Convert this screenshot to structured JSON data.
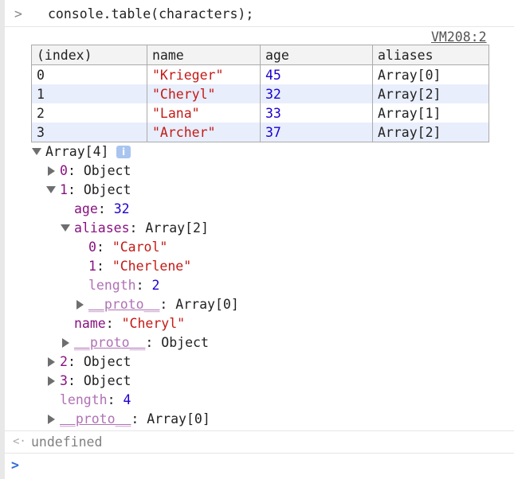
{
  "console": {
    "command_prompt": ">",
    "command": "console.table(characters);",
    "source_link": "VM208:2",
    "table": {
      "headers": [
        "(index)",
        "name",
        "age",
        "aliases"
      ],
      "rows": [
        {
          "index": "0",
          "name": "\"Krieger\"",
          "age": "45",
          "aliases": "Array[0]"
        },
        {
          "index": "1",
          "name": "\"Cheryl\"",
          "age": "32",
          "aliases": "Array[2]"
        },
        {
          "index": "2",
          "name": "\"Lana\"",
          "age": "33",
          "aliases": "Array[1]"
        },
        {
          "index": "3",
          "name": "\"Archer\"",
          "age": "37",
          "aliases": "Array[2]"
        }
      ]
    },
    "tree": {
      "root_label": "Array[4]",
      "info_badge": "i",
      "item0_key": "0",
      "item0_val": "Object",
      "item1_key": "1",
      "item1_val": "Object",
      "age_key": "age",
      "age_val": "32",
      "aliases_key": "aliases",
      "aliases_val": "Array[2]",
      "alias0_key": "0",
      "alias0_val": "\"Carol\"",
      "alias1_key": "1",
      "alias1_val": "\"Cherlene\"",
      "alias_length_key": "length",
      "alias_length_val": "2",
      "alias_proto_key": "__proto__",
      "alias_proto_val": "Array[0]",
      "name_key": "name",
      "name_val": "\"Cheryl\"",
      "obj_proto_key": "__proto__",
      "obj_proto_val": "Object",
      "item2_key": "2",
      "item2_val": "Object",
      "item3_key": "3",
      "item3_val": "Object",
      "length_key": "length",
      "length_val": "4",
      "root_proto_key": "__proto__",
      "root_proto_val": "Array[0]"
    },
    "return_value": "undefined",
    "return_prompt": "<·",
    "input_prompt": ">"
  }
}
